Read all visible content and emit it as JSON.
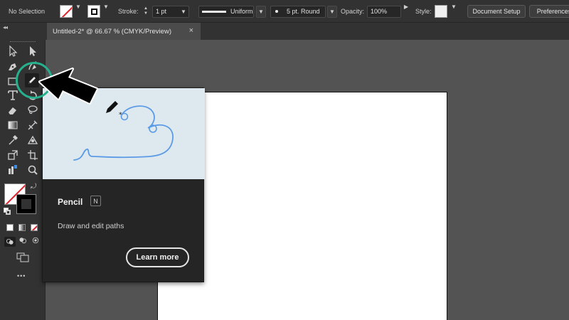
{
  "control_bar": {
    "selection_label": "No Selection",
    "stroke_label": "Stroke:",
    "stroke_weight": "1 pt",
    "stroke_style": "Uniform",
    "brush_label": "5 pt. Round",
    "opacity_label": "Opacity:",
    "opacity_value": "100%",
    "style_label": "Style:",
    "document_setup_label": "Document Setup",
    "preferences_label": "Preferences"
  },
  "document": {
    "tab_title": "Untitled-2* @ 66.67 % (CMYK/Preview)",
    "close_glyph": "×"
  },
  "panel": {
    "collapse_glyph": "◂◂"
  },
  "toolbar": {
    "more_tools_glyph": "•••",
    "active_tool": "pencil-tool"
  },
  "tooltip": {
    "title": "Pencil",
    "shortcut": "N",
    "description": "Draw and edit paths",
    "learn_more_label": "Learn more"
  },
  "colors": {
    "highlight_ring": "#27b08e",
    "fill_none_slash": "#e0202a",
    "preview_bg": "#dde9ef",
    "preview_path": "#5b9be6"
  }
}
